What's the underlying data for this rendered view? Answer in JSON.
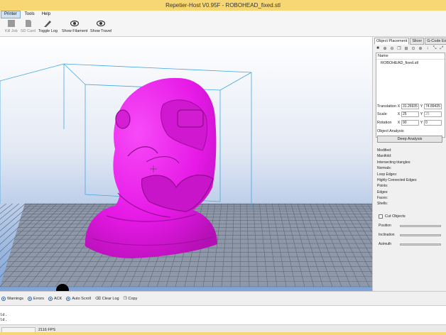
{
  "window": {
    "title": "Repetier-Host V0.95F - ROBOHEAD_fixed.stl"
  },
  "menu": {
    "items": [
      "Printer",
      "Tools",
      "Help"
    ]
  },
  "toolbar": {
    "kill_job": "Kill Job",
    "sd_card": "SD Card",
    "toggle_log": "Toggle Log",
    "show_filament": "Show Filament",
    "show_travel": "Show Travel"
  },
  "panel": {
    "tabs": [
      "Object Placement",
      "Slicer",
      "G-Code Editor"
    ],
    "list_header": "Name",
    "objects": [
      "ROBOHEAD_fixed.stl"
    ],
    "translation": {
      "label": "Translation",
      "x": "31.26935",
      "y": "74.89435"
    },
    "scale": {
      "label": "Scale",
      "x": "25",
      "y": "25"
    },
    "rotation": {
      "label": "Rotation",
      "x": "90",
      "y": "0"
    },
    "analysis_title": "Object Analysis",
    "deep_analysis": "Deep Analysis",
    "analysis_items": [
      "Modified:",
      "Manifold:",
      "Intersecting triangles:",
      "Normals:",
      "Loop Edges:",
      "Highly Connected Edges:",
      "Points:",
      "Edges:",
      "Faces:",
      "Shells:"
    ],
    "cut_objects": "Cut Objects",
    "sliders": [
      "Position",
      "Inclination",
      "Azimuth"
    ]
  },
  "log": {
    "options": [
      "Warnings",
      "Errors",
      "ACK",
      "Auto Scroll",
      "Clear Log",
      "Copy"
    ],
    "lines": [
      "ld.",
      "ld."
    ]
  },
  "status": {
    "fps": "2116 FPS"
  },
  "colors": {
    "model": "#e619e6",
    "bed": "#8a96a8",
    "title_bar": "#f7d774"
  }
}
